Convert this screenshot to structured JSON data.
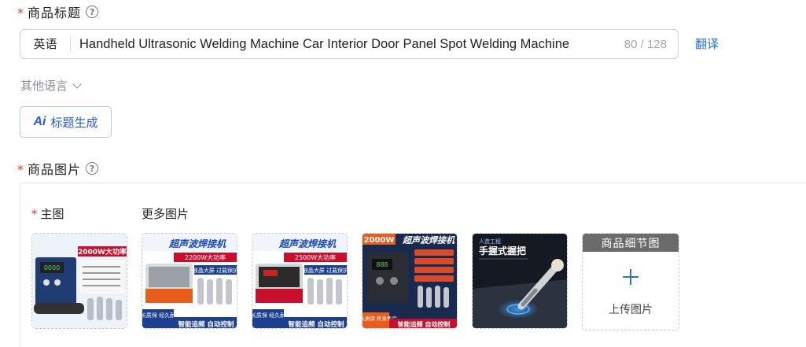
{
  "title_field": {
    "label": "商品标题",
    "language": "英语",
    "value": "Handheld Ultrasonic Welding Machine Car Interior Door Panel Spot Welding Machine",
    "counter": "80 / 128",
    "translate_label": "翻译",
    "other_languages": "其他语言",
    "ai_generate_label": "标题生成",
    "ai_icon": "Ai"
  },
  "images_field": {
    "label": "商品图片",
    "main_label": "主图",
    "more_label": "更多图片",
    "upload_header": "商品细节图",
    "upload_label": "上传图片"
  },
  "thumbnails": [
    {
      "banner": "2000W大功率",
      "colors": {
        "bg": "#e9f0fa",
        "machine": "#1e3a6e"
      }
    },
    {
      "title": "超声波焊接机",
      "banner": "2200W大功率",
      "foot1": "超长质保 经久耐用",
      "foot2": "智能追频 自动控制",
      "note": "液晶大屏 过载保护"
    },
    {
      "title": "超声波焊接机",
      "banner": "2500W大功率",
      "foot1": "超长质保 经久耐用",
      "foot2": "智能追频 自动控制",
      "note": "液晶大屏 过载保护"
    },
    {
      "banner": "2000W",
      "title": "超声波焊接机",
      "foot1": "超长质保 终身售后",
      "foot2": "智能追频 自动控制"
    },
    {
      "small": "人造工程",
      "title": "手握式握把"
    }
  ],
  "colors": {
    "required": "#e5352b",
    "link": "#1f6fd9",
    "accent": "#2a5cc9"
  }
}
